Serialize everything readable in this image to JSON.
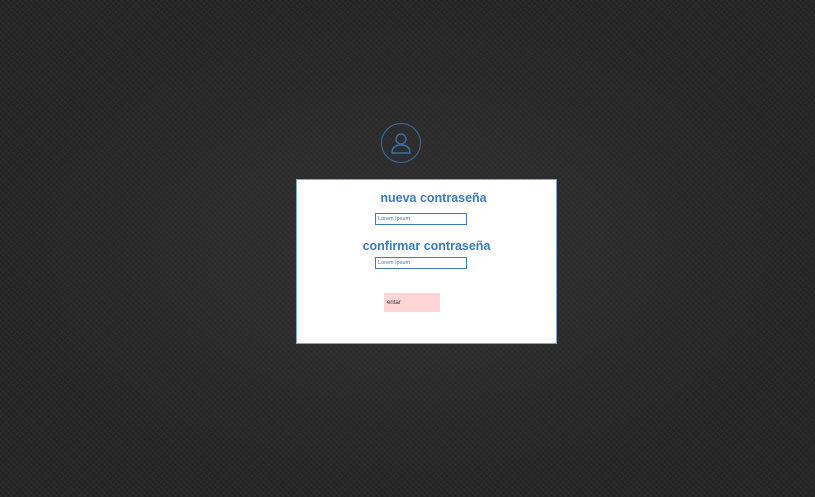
{
  "avatar": {
    "icon": "user-icon"
  },
  "form": {
    "new_password_label": "nueva contraseña",
    "new_password_value": "Lorem Ipsum",
    "confirm_password_label": "confirmar contraseña",
    "confirm_password_value": "Lorem Ipsum",
    "submit_label": "entar"
  },
  "colors": {
    "accent": "#3a7abf",
    "button_bg": "#ffd5d5",
    "card_bg": "#ffffff",
    "page_bg": "#242424"
  }
}
